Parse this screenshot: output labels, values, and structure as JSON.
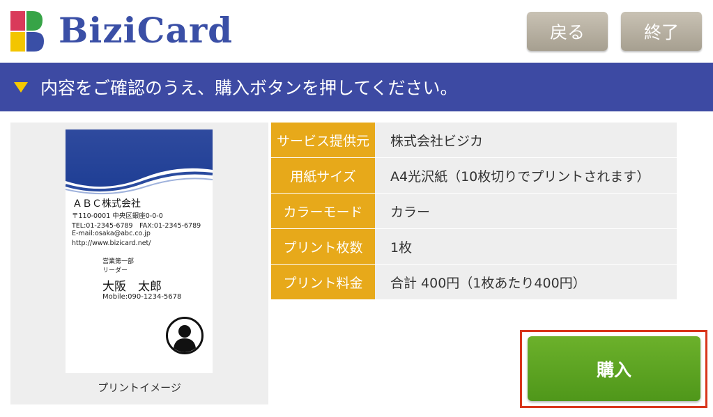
{
  "header": {
    "logo_text": "BiziCard",
    "back_label": "戻る",
    "end_label": "終了"
  },
  "banner": {
    "message": "内容をご確認のうえ、購入ボタンを押してください。"
  },
  "card": {
    "company": "ＡＢＣ株式会社",
    "address": "〒110-0001 中央区銀座0-0-0",
    "tel_fax": "TEL:01-2345-6789　FAX:01-2345-6789",
    "email": "E-mail:osaka@abc.co.jp",
    "web": "http://www.bizicard.net/",
    "department": "営業第一部",
    "title": "リーダー",
    "name": "大阪　太郎",
    "mobile": "Mobile:090-1234-5678"
  },
  "preview": {
    "caption": "プリントイメージ"
  },
  "info_rows": [
    {
      "label": "サービス提供元",
      "value": "株式会社ビジカ"
    },
    {
      "label": "用紙サイズ",
      "value": "A4光沢紙（10枚切りでプリントされます）"
    },
    {
      "label": "カラーモード",
      "value": "カラー"
    },
    {
      "label": "プリント枚数",
      "value": "1枚"
    },
    {
      "label": "プリント料金",
      "value": "合計 400円（1枚あたり400円）"
    }
  ],
  "purchase": {
    "label": "購入"
  },
  "colors": {
    "brand_blue": "#3d4aa3",
    "label_orange": "#e7a91a",
    "buy_green": "#5ca522",
    "highlight_red": "#d8351b"
  }
}
